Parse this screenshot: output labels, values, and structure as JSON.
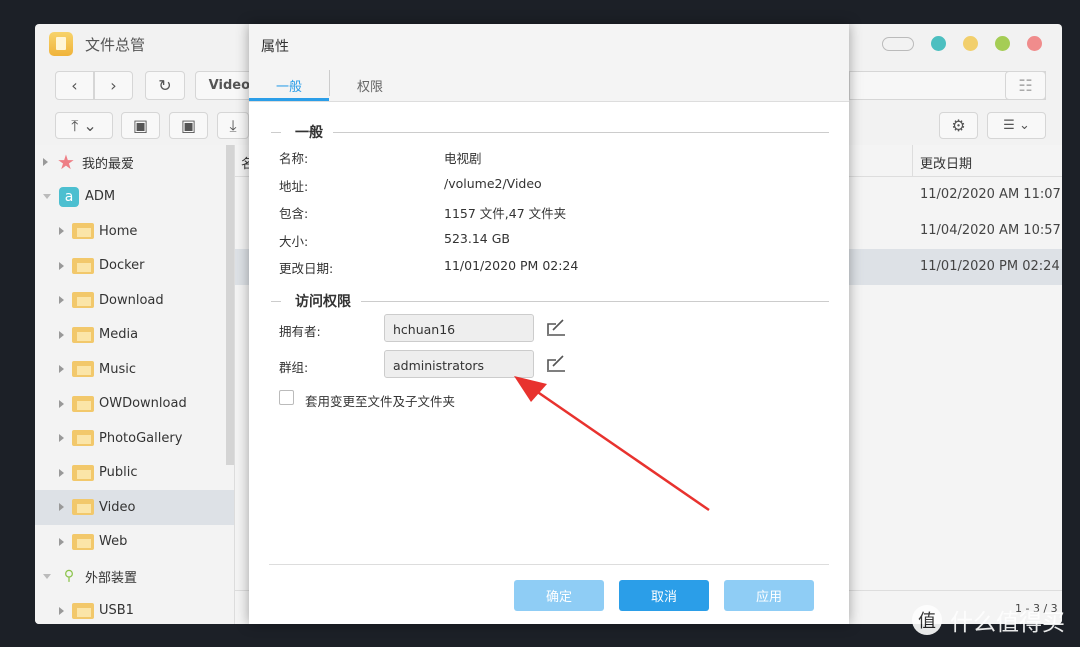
{
  "app": {
    "title": "文件总管",
    "path_partial": "Video",
    "pagination": "1 - 3 / 3"
  },
  "window_controls": {
    "colors": [
      "#4cbfc0",
      "#f2cf6c",
      "#a5cd55",
      "#f08c8c"
    ]
  },
  "sidebar": {
    "items": [
      {
        "label": "我的最爱",
        "icon": "star-icon",
        "level": 0
      },
      {
        "label": "ADM",
        "icon": "adm-icon",
        "level": 0,
        "expanded": true
      },
      {
        "label": "Home",
        "level": 1
      },
      {
        "label": "Docker",
        "level": 1
      },
      {
        "label": "Download",
        "level": 1
      },
      {
        "label": "Media",
        "level": 1
      },
      {
        "label": "Music",
        "level": 1
      },
      {
        "label": "OWDownload",
        "level": 1
      },
      {
        "label": "PhotoGallery",
        "level": 1
      },
      {
        "label": "Public",
        "level": 1
      },
      {
        "label": "Video",
        "level": 1,
        "selected": true
      },
      {
        "label": "Web",
        "level": 1
      },
      {
        "label": "外部装置",
        "icon": "usb-icon",
        "level": 0,
        "expanded": true
      },
      {
        "label": "USB1",
        "level": 1
      }
    ]
  },
  "list": {
    "col_name_partial": "名",
    "col_date": "更改日期",
    "rows": [
      {
        "date": "11/02/2020 AM 11:07"
      },
      {
        "date": "11/04/2020 AM 10:57"
      },
      {
        "date": "11/01/2020 PM 02:24",
        "selected": true
      }
    ]
  },
  "dialog": {
    "title": "属性",
    "tabs": [
      {
        "label": "一般",
        "active": true
      },
      {
        "label": "权限"
      }
    ],
    "general_section": "一般",
    "general": [
      {
        "k": "名称:",
        "v": "电视剧"
      },
      {
        "k": "地址:",
        "v": "/volume2/Video"
      },
      {
        "k": "包含:",
        "v": "1157 文件,47 文件夹"
      },
      {
        "k": "大小:",
        "v": "523.14 GB"
      },
      {
        "k": "更改日期:",
        "v": "11/01/2020 PM 02:24"
      }
    ],
    "access_section": "访问权限",
    "owner_label": "拥有者:",
    "owner": "hchuan16",
    "group_label": "群组:",
    "group": "administrators",
    "apply_sub": "套用变更至文件及子文件夹",
    "ok": "确定",
    "cancel": "取消",
    "apply": "应用",
    "accent": "#2b9ee8"
  },
  "watermark": {
    "icon_char": "值",
    "text": "什么值得买"
  }
}
